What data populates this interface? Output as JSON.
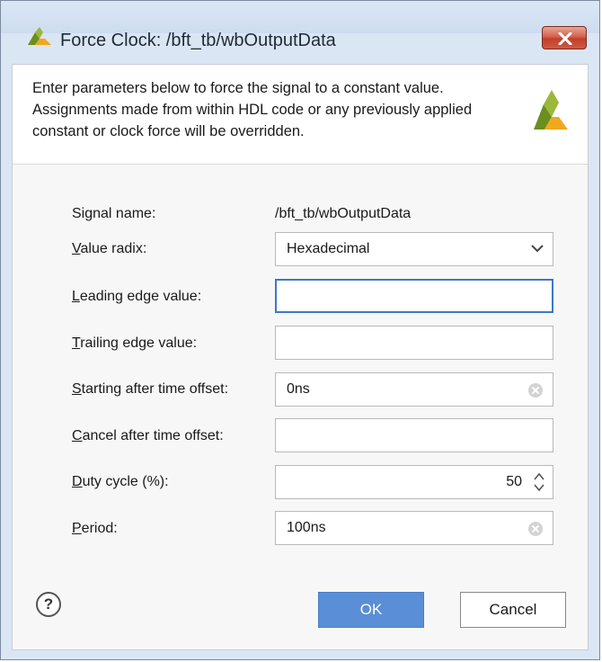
{
  "window": {
    "title": "Force Clock:  /bft_tb/wbOutputData",
    "close_icon": "close-x-icon"
  },
  "banner": {
    "text": "Enter parameters below to force the signal to a constant value. Assignments made from within HDL code or any previously applied constant or clock force will be overridden.",
    "logo_icon": "vivado-logo-icon"
  },
  "form": {
    "signal_name": {
      "label": "Signal name:",
      "value": "/bft_tb/wbOutputData"
    },
    "value_radix": {
      "label_first": "V",
      "label_rest": "alue radix:",
      "value": "Hexadecimal"
    },
    "leading_edge": {
      "label_first": "L",
      "label_rest": "eading edge value:",
      "value": ""
    },
    "trailing_edge": {
      "label_first": "T",
      "label_rest": "railing edge value:",
      "value": ""
    },
    "starting_after": {
      "label_first": "S",
      "label_rest": "tarting after time offset:",
      "value": "0ns"
    },
    "cancel_after": {
      "label_first": "C",
      "label_rest": "ancel after time offset:",
      "value": ""
    },
    "duty_cycle": {
      "label_first": "D",
      "label_rest": "uty cycle (%):",
      "value": "50"
    },
    "period": {
      "label_first": "P",
      "label_rest": "eriod:",
      "value": "100ns"
    }
  },
  "footer": {
    "help_label": "?",
    "ok_label": "OK",
    "cancel_label": "Cancel"
  },
  "colors": {
    "ok_button": "#5a8ed6",
    "focus_border": "#3c78c8",
    "logo_green": "#6b8e1f",
    "logo_gold": "#f0a81e"
  }
}
